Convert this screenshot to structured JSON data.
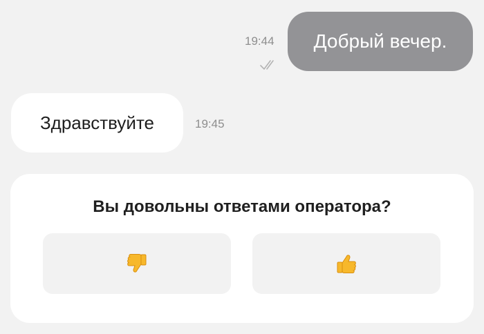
{
  "messages": {
    "outgoing": {
      "text": "Добрый вечер.",
      "time": "19:44",
      "status_icon": "double-check-icon"
    },
    "incoming": {
      "text": "Здравствуйте",
      "time": "19:45"
    }
  },
  "rating": {
    "question": "Вы довольны ответами оператора?",
    "dislike_icon": "thumbs-down-icon",
    "like_icon": "thumbs-up-icon"
  },
  "colors": {
    "background": "#f2f2f2",
    "outgoing_bubble": "#939396",
    "incoming_bubble": "#ffffff",
    "emoji_yellow": "#f7b82b"
  }
}
